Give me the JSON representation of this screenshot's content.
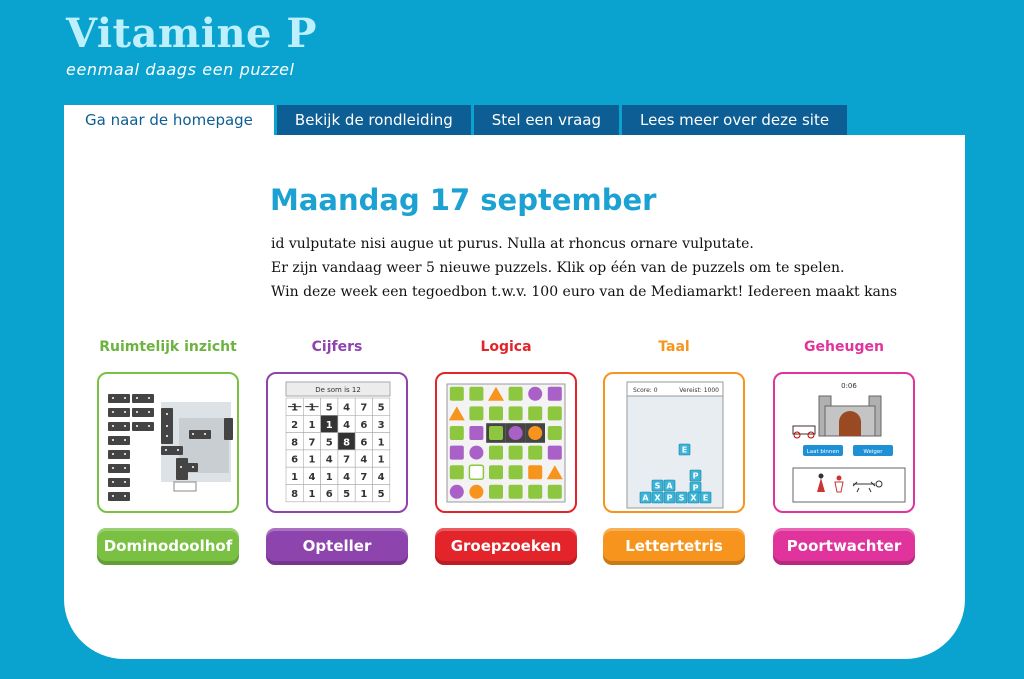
{
  "logo": {
    "title": "Vitamine P",
    "subtitle": "eenmaal daags een puzzel"
  },
  "nav": {
    "tabs": [
      {
        "label": "Ga naar de homepage"
      },
      {
        "label": "Bekijk de rondleiding"
      },
      {
        "label": "Stel een vraag"
      },
      {
        "label": "Lees meer over deze site"
      }
    ]
  },
  "main": {
    "date": "Maandag 17 september",
    "intro": [
      "id vulputate nisi augue ut purus. Nulla at rhoncus ornare vulputate.",
      "Er zijn vandaag weer 5 nieuwe puzzels. Klik op één van de puzzels om te spelen.",
      "Win deze week een tegoedbon t.w.v. 100 euro van de Mediamarkt! Iedereen maakt kans"
    ]
  },
  "puzzles": [
    {
      "category": "Ruimtelijk inzicht",
      "button": "Dominodoolhof",
      "color": "#7ac143",
      "catColor": "#6cb33f"
    },
    {
      "category": "Cijfers",
      "button": "Opteller",
      "color": "#8e44ad",
      "catColor": "#8e44ad",
      "thumb": {
        "header": "De som is 12",
        "grid": [
          [
            "1",
            "1",
            "5",
            "4",
            "7",
            "5"
          ],
          [
            "2",
            "1",
            "1",
            "4",
            "6",
            "3"
          ],
          [
            "8",
            "7",
            "5",
            "8",
            "6",
            "1"
          ],
          [
            "6",
            "1",
            "4",
            "7",
            "4",
            "1"
          ],
          [
            "1",
            "4",
            "1",
            "4",
            "7",
            "4"
          ],
          [
            "8",
            "1",
            "6",
            "5",
            "1",
            "5"
          ]
        ]
      }
    },
    {
      "category": "Logica",
      "button": "Groepzoeken",
      "color": "#e3242b",
      "catColor": "#e3242b"
    },
    {
      "category": "Taal",
      "button": "Lettertetris",
      "color": "#f7941d",
      "catColor": "#f7941d",
      "thumb": {
        "score": "Score: 0",
        "target": "Vereist: 1000",
        "letters": [
          "E",
          "S",
          "A",
          "P",
          "P",
          "A",
          "X",
          "P",
          "S",
          "X",
          "E"
        ]
      }
    },
    {
      "category": "Geheugen",
      "button": "Poortwachter",
      "color": "#e0339b",
      "catColor": "#e0339b",
      "thumb": {
        "timer": "0:06",
        "admit": "Laat binnen",
        "refuse": "Weiger"
      }
    }
  ]
}
